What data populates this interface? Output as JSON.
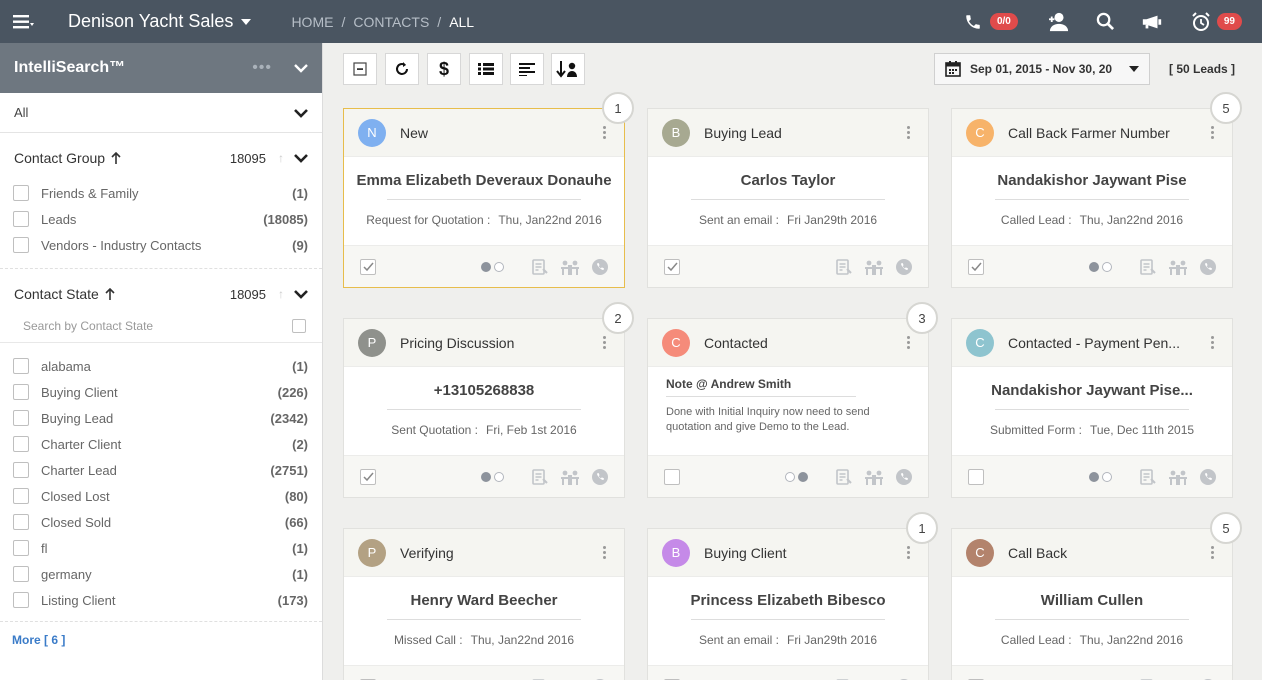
{
  "header": {
    "app_title": "Denison Yacht Sales",
    "breadcrumb": [
      "HOME",
      "CONTACTS",
      "ALL"
    ],
    "call_badge": "0/0",
    "alarm_badge": "99"
  },
  "sidebar": {
    "title": "IntelliSearch™",
    "filter_value": "All",
    "contact_group": {
      "label": "Contact Group",
      "count": "18095",
      "items": [
        {
          "label": "Friends & Family",
          "count": "(1)"
        },
        {
          "label": "Leads",
          "count": "(18085)"
        },
        {
          "label": "Vendors - Industry Contacts",
          "count": "(9)"
        }
      ]
    },
    "contact_state": {
      "label": "Contact State",
      "count": "18095",
      "search_placeholder": "Search by Contact State",
      "items": [
        {
          "label": "alabama",
          "count": "(1)"
        },
        {
          "label": "Buying Client",
          "count": "(226)"
        },
        {
          "label": "Buying Lead",
          "count": "(2342)"
        },
        {
          "label": "Charter Client",
          "count": "(2)"
        },
        {
          "label": "Charter Lead",
          "count": "(2751)"
        },
        {
          "label": "Closed Lost",
          "count": "(80)"
        },
        {
          "label": "Closed Sold",
          "count": "(66)"
        },
        {
          "label": "fl",
          "count": "(1)"
        },
        {
          "label": "germany",
          "count": "(1)"
        },
        {
          "label": "Listing Client",
          "count": "(173)"
        }
      ]
    },
    "more_label": "More [ 6 ]"
  },
  "toolbar": {
    "date_range": "Sep 01, 2015 - Nov 30, 20",
    "leads_count": "[ 50 Leads ]"
  },
  "cards": [
    {
      "initial": "N",
      "color": "#7fb0f0",
      "status": "New",
      "name": "Emma Elizabeth Deveraux Donauhe",
      "activity_label": "Request for Quotation :",
      "activity_date": "Thu, Jan22nd 2016",
      "badge": "1"
    },
    {
      "initial": "B",
      "color": "#a7a991",
      "status": "Buying Lead",
      "name": "Carlos Taylor",
      "activity_label": "Sent an email :",
      "activity_date": "Fri Jan29th 2016",
      "badge": ""
    },
    {
      "initial": "C",
      "color": "#f7b36a",
      "status": "Call Back Farmer Number",
      "name": "Nandakishor Jaywant Pise",
      "activity_label": "Called Lead :",
      "activity_date": "Thu, Jan22nd 2016",
      "badge": "5"
    },
    {
      "initial": "P",
      "color": "#8f918c",
      "status": "Pricing Discussion",
      "name": "+13105268838",
      "activity_label": "Sent Quotation :",
      "activity_date": "Fri, Feb 1st 2016",
      "badge": "2"
    },
    {
      "initial": "C",
      "color": "#f58b7a",
      "status": "Contacted",
      "note_title": "Note @ Andrew Smith",
      "note_text": "Done with Initial Inquiry now need to send quotation and give Demo to the Lead.",
      "badge": "3"
    },
    {
      "initial": "C",
      "color": "#8ec4cf",
      "status": "Contacted - Payment Pen...",
      "name": "Nandakishor Jaywant Pise...",
      "activity_label": "Submitted Form :",
      "activity_date": "Tue, Dec 11th 2015",
      "badge": ""
    },
    {
      "initial": "P",
      "color": "#b3a183",
      "status": "Verifying",
      "name": "Henry Ward Beecher",
      "activity_label": "Missed Call :",
      "activity_date": "Thu, Jan22nd 2016",
      "badge": ""
    },
    {
      "initial": "B",
      "color": "#c58ae8",
      "status": "Buying Client",
      "name": "Princess Elizabeth Bibesco",
      "activity_label": "Sent an email :",
      "activity_date": "Fri Jan29th 2016",
      "badge": "1"
    },
    {
      "initial": "C",
      "color": "#b3836c",
      "status": "Call Back",
      "name": "William Cullen",
      "activity_label": "Called Lead :",
      "activity_date": "Thu, Jan22nd 2016",
      "badge": "5"
    }
  ]
}
